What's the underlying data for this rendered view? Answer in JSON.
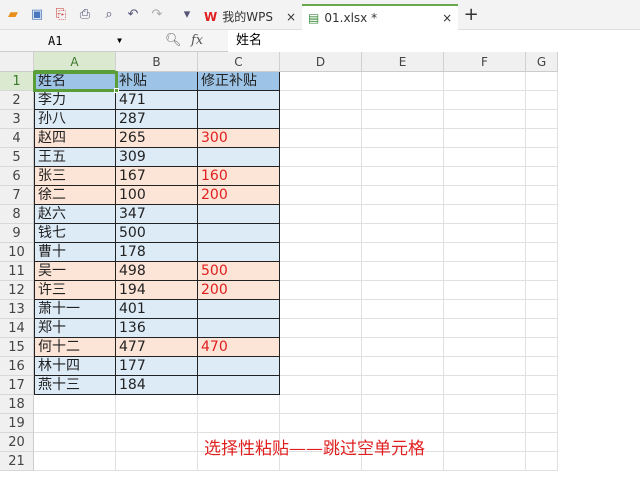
{
  "toolbar": {
    "icons": [
      "open-icon",
      "save-icon",
      "export-pdf-icon",
      "print-icon",
      "print-preview-icon",
      "undo-icon",
      "redo-icon",
      "dropdown-icon"
    ],
    "tabs": [
      {
        "label": "我的WPS",
        "close": "×"
      },
      {
        "label": "01.xlsx *",
        "close": "×"
      }
    ],
    "new_tab": "+"
  },
  "formula_bar": {
    "name_box": "A1",
    "fx": "fx",
    "value": "姓名"
  },
  "columns": [
    "A",
    "B",
    "C",
    "D",
    "E",
    "F",
    "G"
  ],
  "rows": [
    [
      "姓名",
      "补贴",
      "修正补贴"
    ],
    [
      "李力",
      "471",
      ""
    ],
    [
      "孙八",
      "287",
      ""
    ],
    [
      "赵四",
      "265",
      "300"
    ],
    [
      "王五",
      "309",
      ""
    ],
    [
      "张三",
      "167",
      "160"
    ],
    [
      "徐二",
      "100",
      "200"
    ],
    [
      "赵六",
      "347",
      ""
    ],
    [
      "钱七",
      "500",
      ""
    ],
    [
      "曹十",
      "178",
      ""
    ],
    [
      "吴一",
      "498",
      "500"
    ],
    [
      "许三",
      "194",
      "200"
    ],
    [
      "萧十一",
      "401",
      ""
    ],
    [
      "郑十",
      "136",
      ""
    ],
    [
      "何十二",
      "477",
      "470"
    ],
    [
      "林十四",
      "177",
      ""
    ],
    [
      "燕十三",
      "184",
      ""
    ]
  ],
  "total_rows": 21,
  "note": "选择性粘贴——跳过空单元格",
  "colors": {
    "header": "#9dc3e6",
    "blue": "#ddebf7",
    "peach": "#fce4d6",
    "red": "#e02020",
    "select": "#5a9e3a"
  }
}
